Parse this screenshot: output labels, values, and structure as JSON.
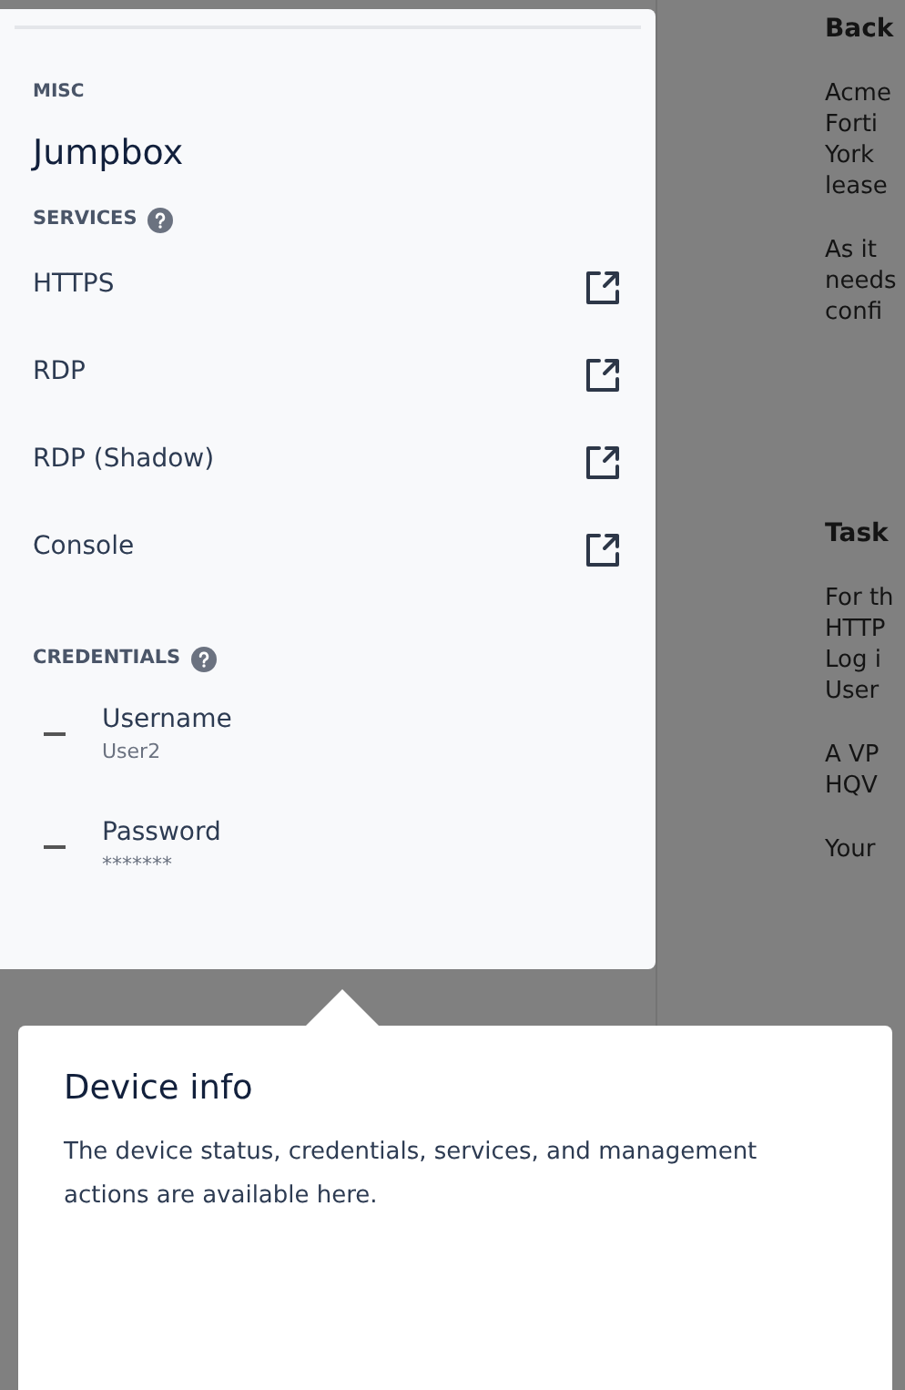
{
  "panel": {
    "category": "MISC",
    "title": "Jumpbox",
    "services_heading": "SERVICES",
    "services": [
      {
        "name": "HTTPS"
      },
      {
        "name": "RDP"
      },
      {
        "name": "RDP (Shadow)"
      },
      {
        "name": "Console"
      }
    ],
    "credentials_heading": "CREDENTIALS",
    "credentials": [
      {
        "label": "Username",
        "value": "User2"
      },
      {
        "label": "Password",
        "value": "*******"
      }
    ]
  },
  "background_text": [
    {
      "kind": "heading",
      "text": "Back"
    },
    {
      "kind": "paragraph",
      "lines": [
        "Acme",
        "Forti",
        "York",
        "lease"
      ]
    },
    {
      "kind": "paragraph",
      "lines": [
        "As it",
        "needs",
        "confi"
      ]
    },
    {
      "kind": "heading",
      "text": "Task"
    },
    {
      "kind": "paragraph",
      "lines": [
        "For th",
        "HTTP",
        "Log i",
        "User"
      ]
    },
    {
      "kind": "paragraph",
      "lines": [
        "A VP",
        "HQV"
      ]
    },
    {
      "kind": "paragraph",
      "lines": [
        "Your"
      ]
    }
  ],
  "popover": {
    "title": "Device info",
    "body": "The device status, credentials, services, and management actions are available here."
  }
}
